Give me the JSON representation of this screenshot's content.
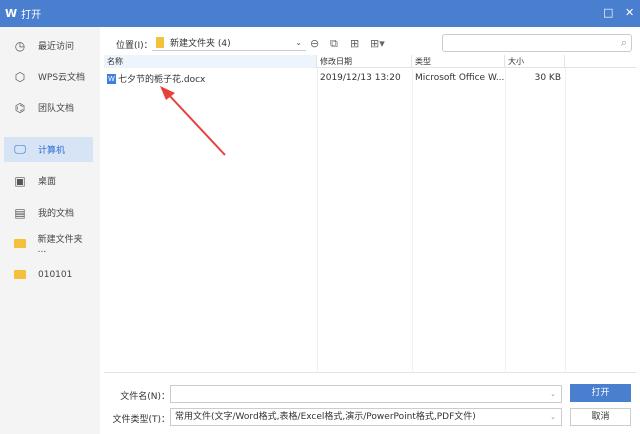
{
  "window": {
    "title": "打开",
    "logo": "W"
  },
  "sidebar": {
    "items": [
      {
        "label": "最近访问",
        "icon": "clock-icon"
      },
      {
        "label": "WPS云文档",
        "icon": "cube-icon"
      },
      {
        "label": "团队文档",
        "icon": "team-icon"
      },
      {
        "label": "计算机",
        "icon": "monitor-icon",
        "selected": true
      },
      {
        "label": "桌面",
        "icon": "desktop-icon"
      },
      {
        "label": "我的文档",
        "icon": "my-documents-icon"
      },
      {
        "label": "新建文件夹 ...",
        "icon": "folder-icon"
      },
      {
        "label": "010101",
        "icon": "folder-icon"
      }
    ]
  },
  "location": {
    "label": "位置(I)：",
    "value": "新建文件夹 (4)"
  },
  "search": {
    "placeholder": ""
  },
  "table": {
    "columns": [
      "名称",
      "修改日期",
      "类型",
      "大小"
    ],
    "rows": [
      {
        "name": "七夕节的栀子花.docx",
        "date": "2019/12/13 13:20",
        "type": "Microsoft Office W...",
        "size": "30 KB"
      }
    ]
  },
  "footer": {
    "filename_label": "文件名(N)：",
    "filename_value": "",
    "filetype_label": "文件类型(T)：",
    "filetype_value": "常用文件(文字/Word格式,表格/Excel格式,演示/PowerPoint格式,PDF文件)",
    "open": "打开",
    "cancel": "取消"
  },
  "colors": {
    "accent": "#4a7fcf",
    "arrow": "#e8413b"
  }
}
